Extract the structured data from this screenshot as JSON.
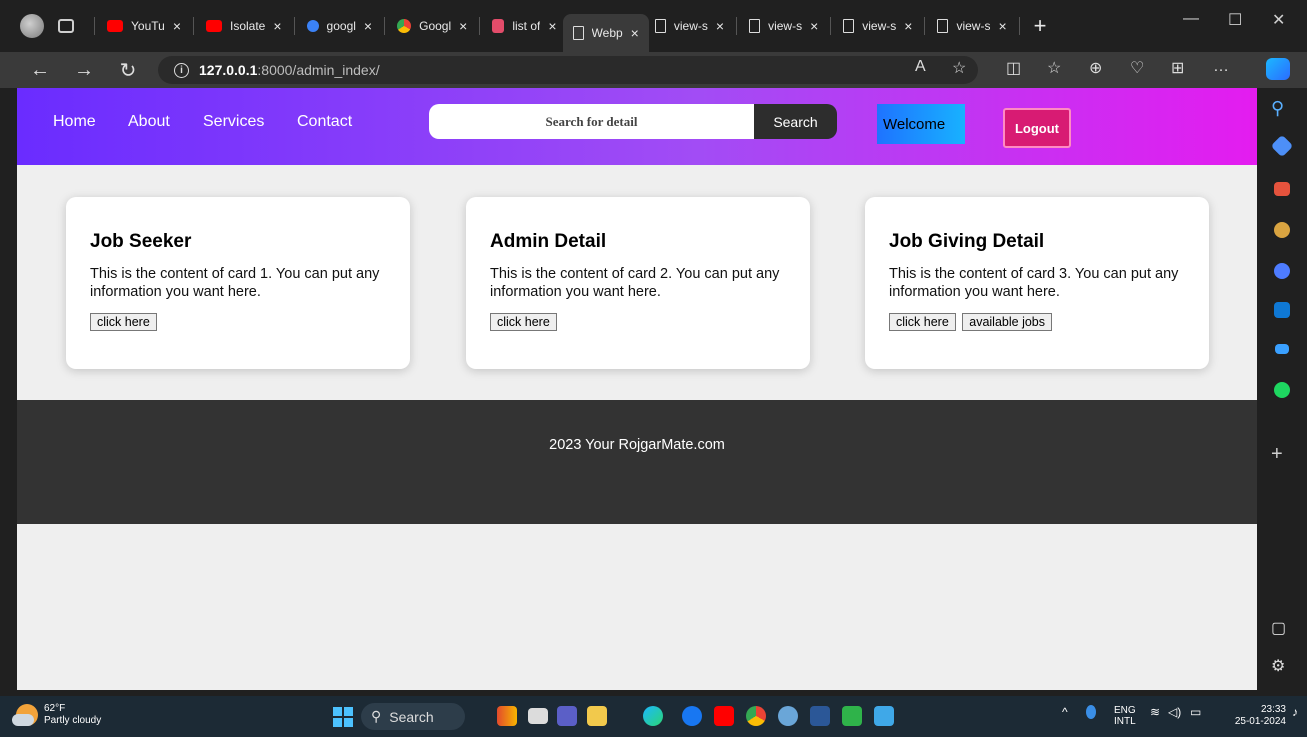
{
  "browser": {
    "tabs": [
      {
        "label": "YouTu",
        "icon": "youtube-icon",
        "color": "#ff0000"
      },
      {
        "label": "Isolate",
        "icon": "youtube-icon",
        "color": "#ff0000"
      },
      {
        "label": "googl",
        "icon": "search-icon",
        "color": "#3b82f6"
      },
      {
        "label": "Googl",
        "icon": "chrome-icon",
        "color": "#34a853"
      },
      {
        "label": "list of",
        "icon": "bookmark-icon",
        "color": "#e34c6a"
      },
      {
        "label": "Webp",
        "icon": "document-icon",
        "color": "#dddddd",
        "active": true
      },
      {
        "label": "view-s",
        "icon": "document-icon",
        "color": "#dddddd"
      },
      {
        "label": "view-s",
        "icon": "document-icon",
        "color": "#dddddd"
      },
      {
        "label": "view-s",
        "icon": "document-icon",
        "color": "#dddddd"
      },
      {
        "label": "view-s",
        "icon": "document-icon",
        "color": "#dddddd"
      }
    ],
    "close_glyph": "×",
    "new_tab_glyph": "+",
    "url_host": "127.0.0.1",
    "url_path": ":8000/admin_index/"
  },
  "page": {
    "nav": [
      "Home",
      "About",
      "Services",
      "Contact"
    ],
    "search_placeholder": "Search for detail",
    "search_button": "Search",
    "welcome": "Welcome",
    "logout": "Logout",
    "cards": [
      {
        "title": "Job Seeker",
        "text": "This is the content of card 1. You can put any information you want here.",
        "buttons": [
          "click here"
        ]
      },
      {
        "title": "Admin Detail",
        "text": "This is the content of card 2. You can put any information you want here.",
        "buttons": [
          "click here"
        ]
      },
      {
        "title": "Job Giving Detail",
        "text": "This is the content of card 3. You can put any information you want here.",
        "buttons": [
          "click here",
          "available jobs"
        ]
      }
    ],
    "footer": "2023 Your RojgarMate.com"
  },
  "taskbar": {
    "temperature": "62°F",
    "weather": "Partly cloudy",
    "search": "Search",
    "lang_top": "ENG",
    "lang_bottom": "INTL",
    "time": "23:33",
    "date": "25-01-2024"
  },
  "colors": {
    "header_start": "#6a2cff",
    "header_end": "#e41cf0",
    "logout": "#d81b73",
    "welcome": "#1e73ff",
    "footer": "#333333"
  }
}
